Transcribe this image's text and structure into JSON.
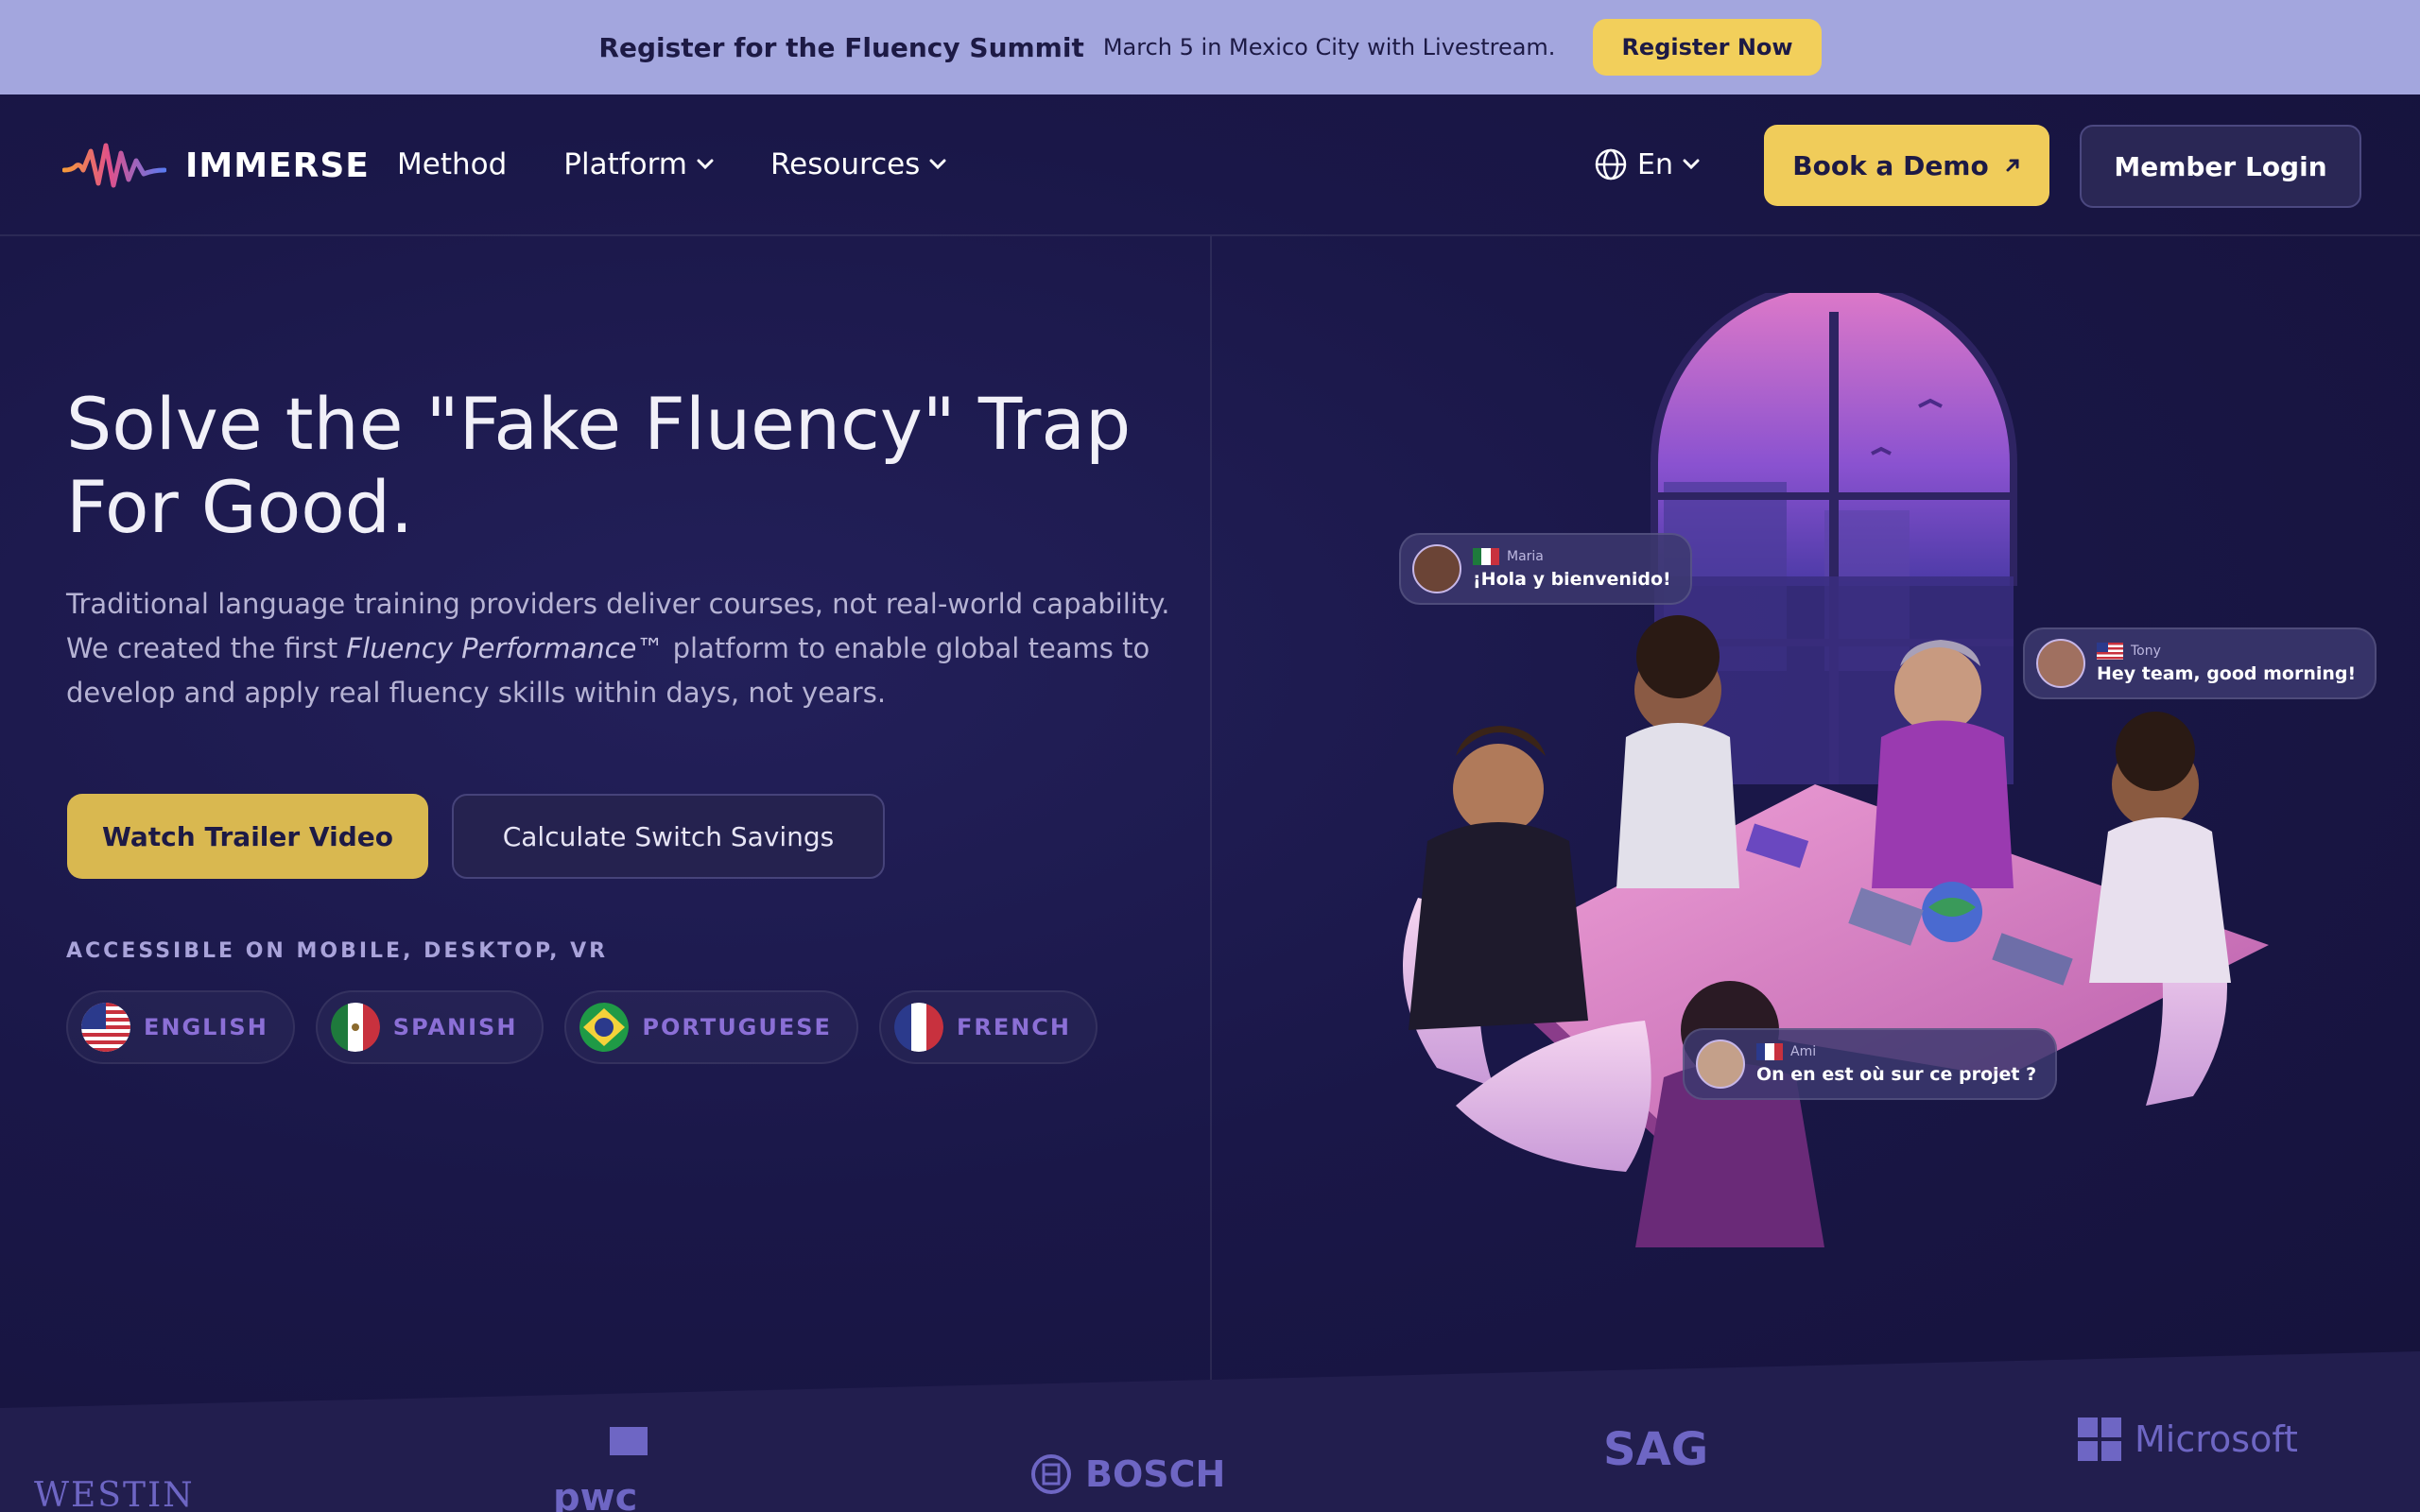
{
  "announcement": {
    "title": "Register for the Fluency Summit",
    "subtitle": "March 5 in Mexico City with Livestream.",
    "cta": "Register Now"
  },
  "nav": {
    "brand": "IMMERSE",
    "links": [
      {
        "label": "Method"
      },
      {
        "label": "Platform",
        "has_dropdown": true
      },
      {
        "label": "Resources",
        "has_dropdown": true
      }
    ],
    "language": "En",
    "demo_label": "Book a Demo",
    "login_label": "Member Login"
  },
  "hero": {
    "title_line1": "Solve the \"Fake Fluency\" Trap",
    "title_line2": "For Good.",
    "desc_part1": "Traditional language training providers deliver courses, not real-world capability. We created the first ",
    "desc_emphasis": "Fluency Performance™",
    "desc_part2": " platform to enable global teams to develop and apply real fluency skills within days, not years.",
    "primary_cta": "Watch Trailer Video",
    "secondary_cta": "Calculate Switch Savings",
    "access_label": "ACCESSIBLE ON MOBILE, DESKTOP, VR",
    "languages": [
      "ENGLISH",
      "SPANISH",
      "PORTUGUESE",
      "FRENCH"
    ]
  },
  "chat_bubbles": [
    {
      "name": "Maria",
      "message": "¡Hola y bienvenido!"
    },
    {
      "name": "Tony",
      "message": "Hey team, good morning!"
    },
    {
      "name": "Ami",
      "message": "On en est où sur ce projet ?"
    }
  ],
  "client_logos": [
    "WESTIN",
    "pwc",
    "BOSCH",
    "SAG",
    "Microsoft"
  ],
  "colors": {
    "accent_yellow": "#f0cc5a",
    "background": "#15123a",
    "announcement_bg": "#a3a6de"
  }
}
